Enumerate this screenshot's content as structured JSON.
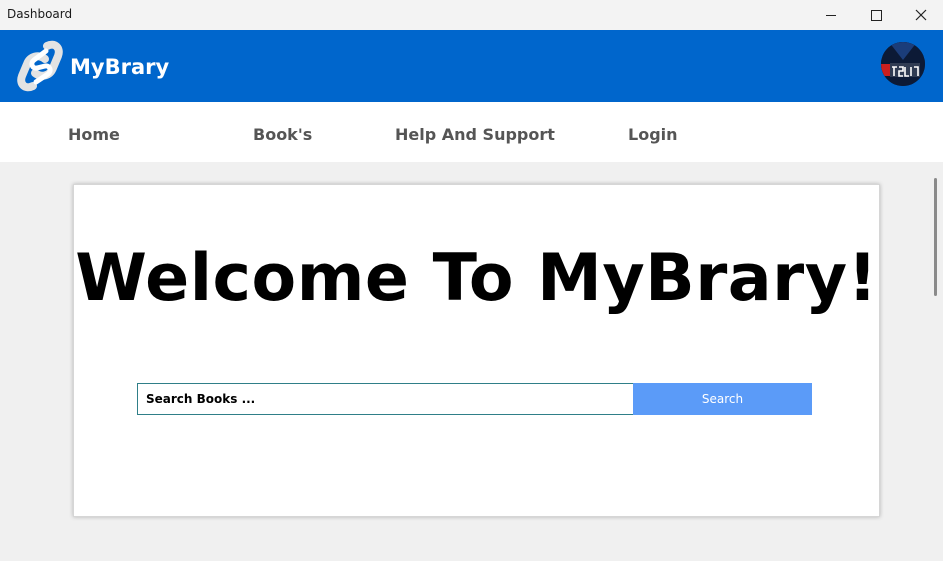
{
  "window": {
    "title": "Dashboard",
    "controls": [
      "minimize",
      "maximize",
      "close"
    ]
  },
  "header": {
    "brand": "MyBrary",
    "logo_icon": "svelte-logo-icon",
    "avatar_icon": "studio-avatar-icon",
    "colors": {
      "background": "#0066cc",
      "text": "#ffffff"
    }
  },
  "nav": {
    "items": [
      {
        "label": "Home"
      },
      {
        "label": "Book's"
      },
      {
        "label": "Help And Support"
      },
      {
        "label": "Login"
      }
    ]
  },
  "main": {
    "heading": "Welcome To MyBrary!",
    "search": {
      "placeholder": "Search Books ...",
      "value": "",
      "button_label": "Search",
      "button_color": "#5b9bf8"
    }
  }
}
